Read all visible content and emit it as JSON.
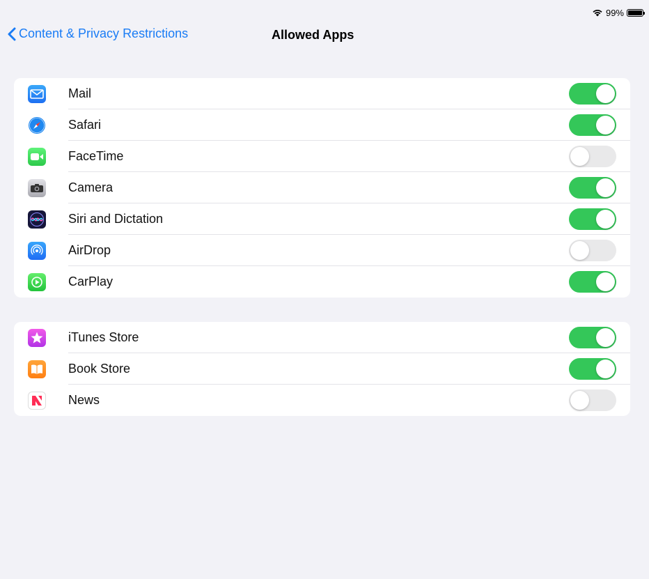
{
  "status": {
    "battery_text": "99%",
    "battery_level": 0.99
  },
  "nav": {
    "back_label": "Content & Privacy Restrictions",
    "title": "Allowed Apps"
  },
  "groups": [
    {
      "items": [
        {
          "label": "Mail",
          "icon": "mail-icon",
          "enabled": true
        },
        {
          "label": "Safari",
          "icon": "safari-icon",
          "enabled": true
        },
        {
          "label": "FaceTime",
          "icon": "facetime-icon",
          "enabled": false
        },
        {
          "label": "Camera",
          "icon": "camera-icon",
          "enabled": true
        },
        {
          "label": "Siri and Dictation",
          "icon": "siri-icon",
          "enabled": true
        },
        {
          "label": "AirDrop",
          "icon": "airdrop-icon",
          "enabled": false
        },
        {
          "label": "CarPlay",
          "icon": "carplay-icon",
          "enabled": true
        }
      ]
    },
    {
      "items": [
        {
          "label": "iTunes Store",
          "icon": "itunes-store-icon",
          "enabled": true
        },
        {
          "label": "Book Store",
          "icon": "book-store-icon",
          "enabled": true
        },
        {
          "label": "News",
          "icon": "news-icon",
          "enabled": false
        }
      ]
    }
  ],
  "colors": {
    "accent": "#1a7cf5",
    "toggle_on": "#34c759",
    "toggle_off": "#e9e9ea",
    "background": "#f2f2f7"
  }
}
